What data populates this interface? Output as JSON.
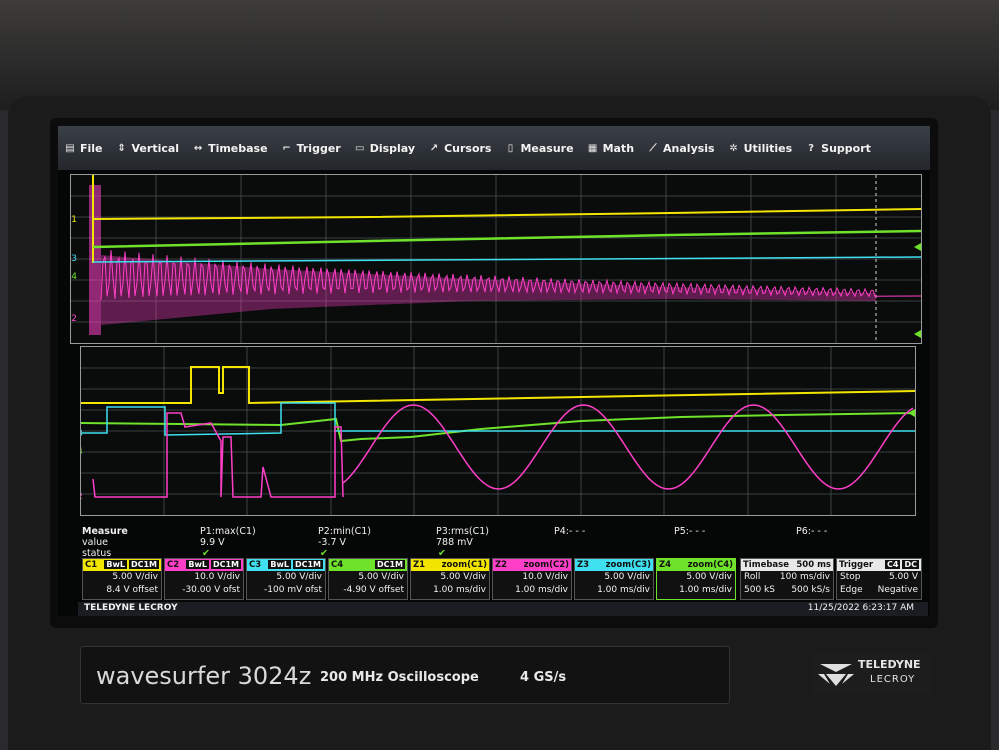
{
  "menu": [
    {
      "label": "File",
      "icon": "file-icon",
      "glyph": "▤"
    },
    {
      "label": "Vertical",
      "icon": "vertical-icon",
      "glyph": "⇕"
    },
    {
      "label": "Timebase",
      "icon": "timebase-icon",
      "glyph": "↔"
    },
    {
      "label": "Trigger",
      "icon": "trigger-icon",
      "glyph": "⌐"
    },
    {
      "label": "Display",
      "icon": "display-icon",
      "glyph": "▭"
    },
    {
      "label": "Cursors",
      "icon": "cursors-icon",
      "glyph": "↗"
    },
    {
      "label": "Measure",
      "icon": "measure-icon",
      "glyph": "▯"
    },
    {
      "label": "Math",
      "icon": "math-icon",
      "glyph": "▦"
    },
    {
      "label": "Analysis",
      "icon": "analysis-icon",
      "glyph": "⟋"
    },
    {
      "label": "Utilities",
      "icon": "utilities-icon",
      "glyph": "✲"
    },
    {
      "label": "Support",
      "icon": "support-icon",
      "glyph": "?"
    }
  ],
  "labels": {
    "upper": [
      "C1",
      "C3",
      "C4",
      "C2"
    ],
    "lower": [
      "Z1",
      "Z3",
      "Z4",
      "Z2"
    ]
  },
  "measure": {
    "row_labels": [
      "Measure",
      "value",
      "status"
    ],
    "params": [
      {
        "name": "P1:max(C1)",
        "value": "9.9 V",
        "ok": "✔"
      },
      {
        "name": "P2:min(C1)",
        "value": "-3.7 V",
        "ok": "✔"
      },
      {
        "name": "P3:rms(C1)",
        "value": "788 mV",
        "ok": "✔"
      },
      {
        "name": "P4:- - -",
        "value": "",
        "ok": ""
      },
      {
        "name": "P5:- - -",
        "value": "",
        "ok": ""
      },
      {
        "name": "P6:- - -",
        "value": "",
        "ok": ""
      }
    ]
  },
  "channels": [
    {
      "id": "C1",
      "color": "#f2e600",
      "tag1": "BwL",
      "tag2": "DC1M",
      "l1": "5.00 V/div",
      "l2": "8.4 V offset"
    },
    {
      "id": "C2",
      "color": "#ff3fc8",
      "tag1": "BwL",
      "tag2": "DC1M",
      "l1": "10.0 V/div",
      "l2": "-30.00 V ofst"
    },
    {
      "id": "C3",
      "color": "#3fe0ef",
      "tag1": "BwL",
      "tag2": "DC1M",
      "l1": "5.00 V/div",
      "l2": "-100 mV ofst"
    },
    {
      "id": "C4",
      "color": "#6fe22b",
      "tag1": "",
      "tag2": "DC1M",
      "l1": "5.00 V/div",
      "l2": "-4.90 V offset"
    },
    {
      "id": "Z1",
      "color": "#f2e600",
      "tag1": "zoom(C1)",
      "tag2": "",
      "l1": "5.00 V/div",
      "l2": "1.00 ms/div"
    },
    {
      "id": "Z2",
      "color": "#ff3fc8",
      "tag1": "zoom(C2)",
      "tag2": "",
      "l1": "10.0 V/div",
      "l2": "1.00 ms/div"
    },
    {
      "id": "Z3",
      "color": "#3fe0ef",
      "tag1": "zoom(C3)",
      "tag2": "",
      "l1": "5.00 V/div",
      "l2": "1.00 ms/div"
    },
    {
      "id": "Z4",
      "color": "#6fe22b",
      "tag1": "zoom(C4)",
      "tag2": "",
      "l1": "5.00 V/div",
      "l2": "1.00 ms/div"
    }
  ],
  "timebase": {
    "title": "Timebase",
    "value": "500 ms",
    "r1a": "Roll",
    "r1b": "100 ms/div",
    "r2a": "500 kS",
    "r2b": "500 kS/s"
  },
  "trigger": {
    "title": "Trigger",
    "badges": [
      "C4",
      "DC"
    ],
    "r1a": "Stop",
    "r1b": "5.00 V",
    "r2a": "Edge",
    "r2b": "Negative"
  },
  "status": {
    "brand": "TELEDYNE LECROY",
    "datetime": "11/25/2022 6:23:17 AM"
  },
  "front_panel": {
    "model_prefix": "wavesurfer",
    "model_number": "3024z",
    "spec1": "200 MHz Oscilloscope",
    "spec2": "4 GS/s",
    "logo_line1": "TELEDYNE",
    "logo_line2": "LECROY"
  },
  "colors": {
    "c1": "#f2e600",
    "c2": "#ff3fc8",
    "c3": "#3fe0ef",
    "c4": "#6fe22b"
  }
}
